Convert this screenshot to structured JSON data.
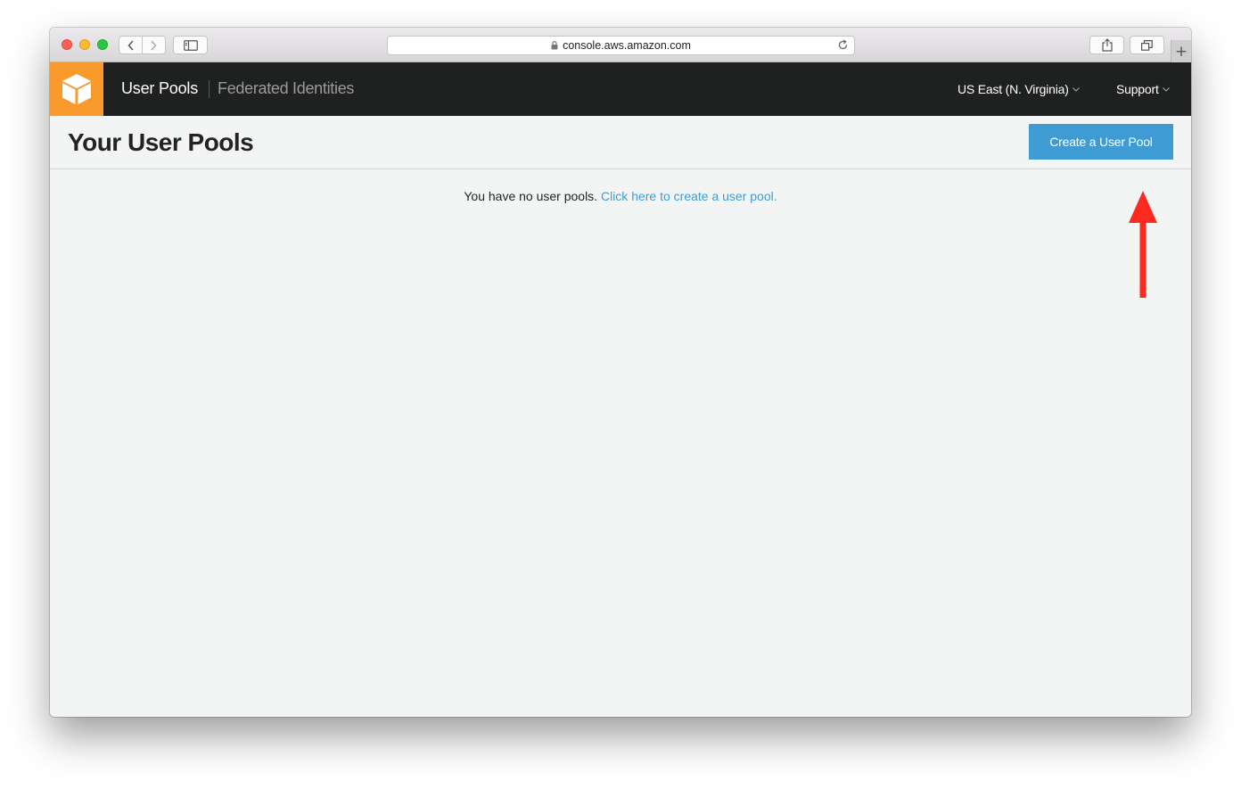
{
  "browser": {
    "url": "console.aws.amazon.com",
    "new_tab_symbol": "+"
  },
  "navbar": {
    "user_pools": "User Pools",
    "federated_identities": "Federated Identities",
    "region": "US East (N. Virginia)",
    "support": "Support"
  },
  "page": {
    "title": "Your User Pools",
    "create_button": "Create a User Pool",
    "empty_text": "You have no user pools.",
    "empty_link": "Click here to create a user pool."
  },
  "colors": {
    "brand_orange": "#f89a2c",
    "navbar_bg": "#1f2020",
    "primary_button": "#3f9bd3",
    "link": "#3f9bd3",
    "annotation_arrow": "#ff2a1f"
  },
  "icons": {
    "logo": "cube-icon",
    "annotation": "red-arrow-up-icon"
  }
}
